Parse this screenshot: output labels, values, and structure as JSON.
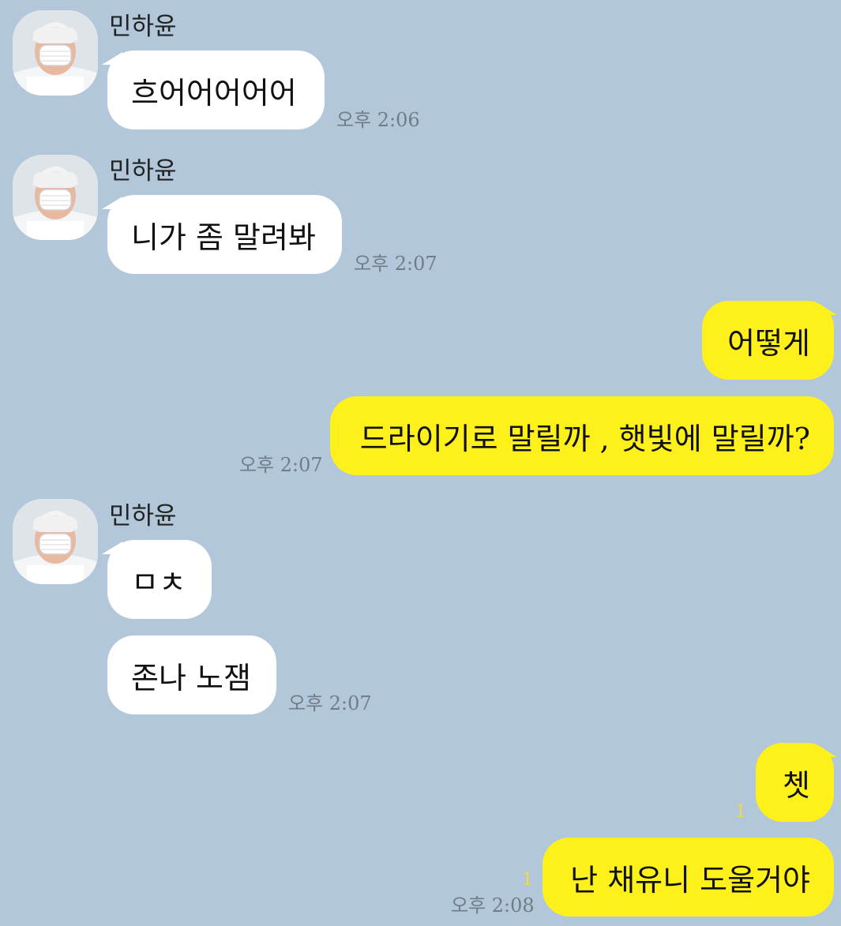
{
  "colors": {
    "background": "#b2c7da",
    "incoming_bubble": "#ffffff",
    "outgoing_bubble": "#fef01b",
    "timestamp": "#6f7d88",
    "unread_count": "#f2d94a"
  },
  "chat": {
    "groups": [
      {
        "sender": "민하윤",
        "avatar_icon": "profile-photo-icon",
        "messages": [
          "흐어어어어어"
        ],
        "time": "오후 2:06"
      },
      {
        "sender": "민하윤",
        "avatar_icon": "profile-photo-icon",
        "messages": [
          "니가 좀 말려봐"
        ],
        "time": "오후 2:07"
      },
      {
        "sender": "me",
        "messages": [
          "어떻게",
          "드라이기로 말릴까 , 햇빛에 말릴까?"
        ],
        "time": "오후 2:07"
      },
      {
        "sender": "민하윤",
        "avatar_icon": "profile-photo-icon",
        "messages": [
          "ㅁㅊ",
          "존나 노잼"
        ],
        "time": "오후 2:07"
      },
      {
        "sender": "me",
        "messages": [
          "쳇",
          "난 채유니 도울거야"
        ],
        "unread": [
          "1",
          "1"
        ],
        "time": "오후 2:08"
      }
    ]
  }
}
